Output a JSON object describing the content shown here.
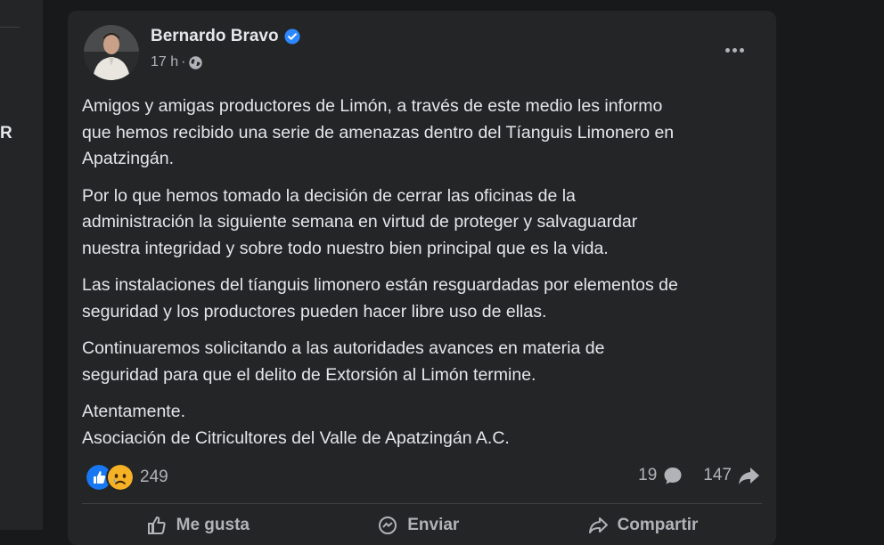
{
  "sidebar": {
    "letter": "R"
  },
  "post": {
    "author": "Bernardo Bravo",
    "time": "17 h",
    "separator": "·",
    "paragraphs": [
      "Amigos y amigas productores de Limón, a través de este medio les informo\nque hemos recibido una serie de amenazas dentro del Tíanguis Limonero en\nApatzingán.",
      "Por lo que hemos tomado la decisión de cerrar las oficinas de la\nadministración la siguiente semana en virtud de proteger y salvaguardar\nnuestra integridad y sobre todo nuestro bien principal que es la vida.",
      "Las instalaciones del tíanguis limonero están resguardadas por elementos de\nseguridad y los productores pueden hacer libre uso de ellas.",
      "Continuaremos solicitando a las autoridades avances en materia de\nseguridad para que el delito de Extorsión al Limón termine.",
      "Atentamente.\nAsociación de Citricultores del Valle de Apatzingán A.C."
    ]
  },
  "reactions": {
    "icons": [
      "like-icon",
      "sad-icon"
    ],
    "count": "249"
  },
  "stats": {
    "comments": "19",
    "shares": "147"
  },
  "actions": {
    "like": "Me gusta",
    "send": "Enviar",
    "share": "Compartir"
  },
  "colors": {
    "background": "#18191a",
    "card": "#242526",
    "text": "#e4e6eb",
    "secondary": "#b0b3b8",
    "verified": "#2d88ff",
    "like": "#1877f2",
    "sad": "#f7b125"
  }
}
